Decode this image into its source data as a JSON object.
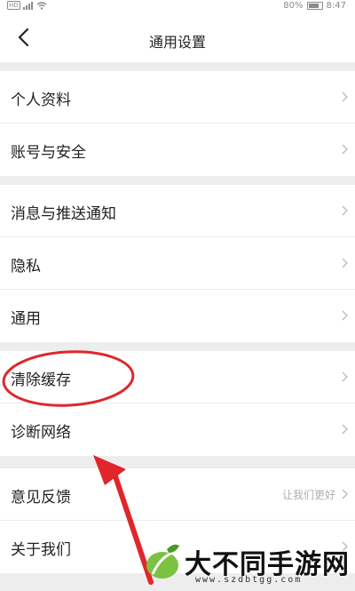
{
  "status_bar": {
    "left_indicators": [
      "HD",
      "signal-icon",
      "wifi-icon"
    ],
    "battery": "80%",
    "time": "8:47"
  },
  "nav": {
    "title": "通用设置",
    "back_icon": "chevron-left-icon"
  },
  "groups": [
    {
      "items": [
        {
          "label": "个人资料"
        },
        {
          "label": "账号与安全"
        }
      ]
    },
    {
      "items": [
        {
          "label": "消息与推送通知"
        },
        {
          "label": "隐私"
        },
        {
          "label": "通用"
        }
      ]
    },
    {
      "items": [
        {
          "label": "清除缓存"
        },
        {
          "label": "诊断网络"
        }
      ]
    },
    {
      "items": [
        {
          "label": "意见反馈",
          "hint": "让我们更好"
        },
        {
          "label": "关于我们"
        }
      ]
    }
  ],
  "annotation": {
    "circled_item": "清除缓存",
    "color": "#e0262b"
  },
  "watermark": {
    "text": "大不同手游网",
    "url": "www.szdbtgg.com"
  },
  "colors": {
    "background": "#ededed",
    "row_background": "#ffffff",
    "text": "#222222",
    "hint": "#b0b0b0",
    "chevron": "#b8b8b8"
  }
}
